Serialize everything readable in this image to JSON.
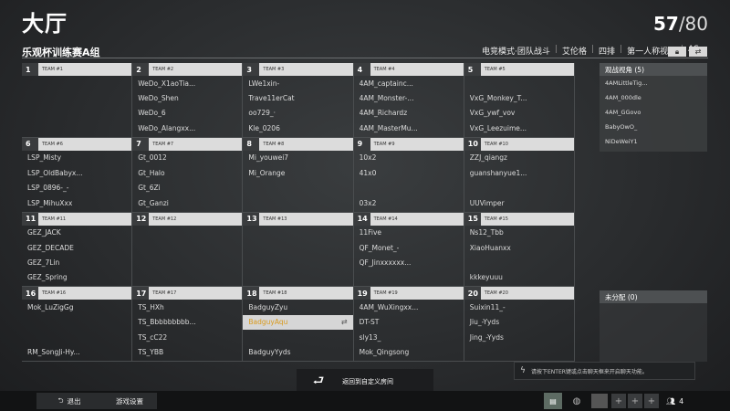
{
  "header": {
    "title": "大厅",
    "count": "57",
    "max": "/80"
  },
  "room": {
    "name": "乐观杯训练赛A组",
    "settings": [
      "电竞模式·团队战斗",
      "艾伦格",
      "四排",
      "第一人称视角",
      "AS"
    ]
  },
  "teams": [
    {
      "num": "1",
      "name": "TEAM #1",
      "players": [
        "",
        "",
        "",
        ""
      ]
    },
    {
      "num": "2",
      "name": "TEAM #2",
      "players": [
        "WeDo_X1aoTia...",
        "WeDo_Shen",
        "WeDo_6",
        "WeDo_Alangxx..."
      ]
    },
    {
      "num": "3",
      "name": "TEAM #3",
      "players": [
        "LWe1xin-",
        "Trave11erCat",
        "oo729_·",
        "Kle_0206"
      ]
    },
    {
      "num": "4",
      "name": "TEAM #4",
      "players": [
        "4AM_captainc...",
        "4AM_Monster-...",
        "4AM_Richardz",
        "4AM_MasterMu..."
      ]
    },
    {
      "num": "5",
      "name": "TEAM #5",
      "players": [
        "",
        "VxG_Monkey_T...",
        "VxG_ywf_vov",
        "VxG_Leezuime..."
      ]
    },
    {
      "num": "6",
      "name": "TEAM #6",
      "players": [
        "LSP_Misty",
        "LSP_OldBabyx...",
        "LSP_0896-_-",
        "LSP_MihuXxx"
      ]
    },
    {
      "num": "7",
      "name": "TEAM #7",
      "players": [
        "Gt_0012",
        "Gt_Halo",
        "Gt_6Zi",
        "Gt_Ganzi"
      ]
    },
    {
      "num": "8",
      "name": "TEAM #8",
      "players": [
        "Mi_youwei7",
        "Mi_Orange",
        "",
        ""
      ]
    },
    {
      "num": "9",
      "name": "TEAM #9",
      "players": [
        "10x2",
        "41x0",
        "",
        "03x2"
      ]
    },
    {
      "num": "10",
      "name": "TEAM #10",
      "players": [
        "ZZJ_qiangz",
        "guanshanyue1...",
        "",
        "UUVimper"
      ]
    },
    {
      "num": "11",
      "name": "TEAM #11",
      "players": [
        "GEZ_JACK",
        "GEZ_DECADE",
        "GEZ_7Lin",
        "GEZ_Spring"
      ]
    },
    {
      "num": "12",
      "name": "TEAM #12",
      "players": [
        "",
        "",
        "",
        ""
      ]
    },
    {
      "num": "13",
      "name": "TEAM #13",
      "players": [
        "",
        "",
        "",
        ""
      ]
    },
    {
      "num": "14",
      "name": "TEAM #14",
      "players": [
        "11Five",
        "QF_Monet_-",
        "QF_Jinxxxxxx...",
        ""
      ]
    },
    {
      "num": "15",
      "name": "TEAM #15",
      "players": [
        "Ns12_Tbb",
        "XiaoHuanxx",
        "",
        "kkkeyuuu"
      ]
    },
    {
      "num": "16",
      "name": "TEAM #16",
      "players": [
        "Mok_LuZigGg",
        "",
        "",
        "RM_SongJi-Hy..."
      ]
    },
    {
      "num": "17",
      "name": "TEAM #17",
      "players": [
        "TS_HXh",
        "TS_Bbbbbbbbb...",
        "TS_cC22",
        "TS_YBB"
      ]
    },
    {
      "num": "18",
      "name": "TEAM #18",
      "players": [
        "BadguyZyu",
        "BadguyAqu",
        "",
        "BadguyYyds"
      ]
    },
    {
      "num": "19",
      "name": "TEAM #19",
      "players": [
        "4AM_WuXingxx...",
        "DT-ST",
        "sly13_",
        "Mok_Qingsong"
      ]
    },
    {
      "num": "20",
      "name": "TEAM #20",
      "players": [
        "Suixin11_-",
        "Jiu_-Yyds",
        "Jing_-Yyds",
        ""
      ]
    }
  ],
  "self_slot": {
    "team_index": 17,
    "slot_index": 1
  },
  "spectators": {
    "title": "观战视角 (5)",
    "items": [
      "4AMLittleTig...",
      "4AM_000dle",
      "4AM_GGovo",
      "BabyOwO_",
      "NiDeWeiY1"
    ]
  },
  "unassigned": {
    "title": "未分配 (0)"
  },
  "chat": {
    "hint": "请按下ENTER键或点击聊天框来开启聊天功能。"
  },
  "return": {
    "label": "返回到自定义房间"
  },
  "bottom": {
    "exit": "退出",
    "game_settings": "游戏设置",
    "party_count": "4"
  },
  "colors": {
    "self_name": "#d99a1c",
    "header_bar": "#dcdcdc"
  }
}
